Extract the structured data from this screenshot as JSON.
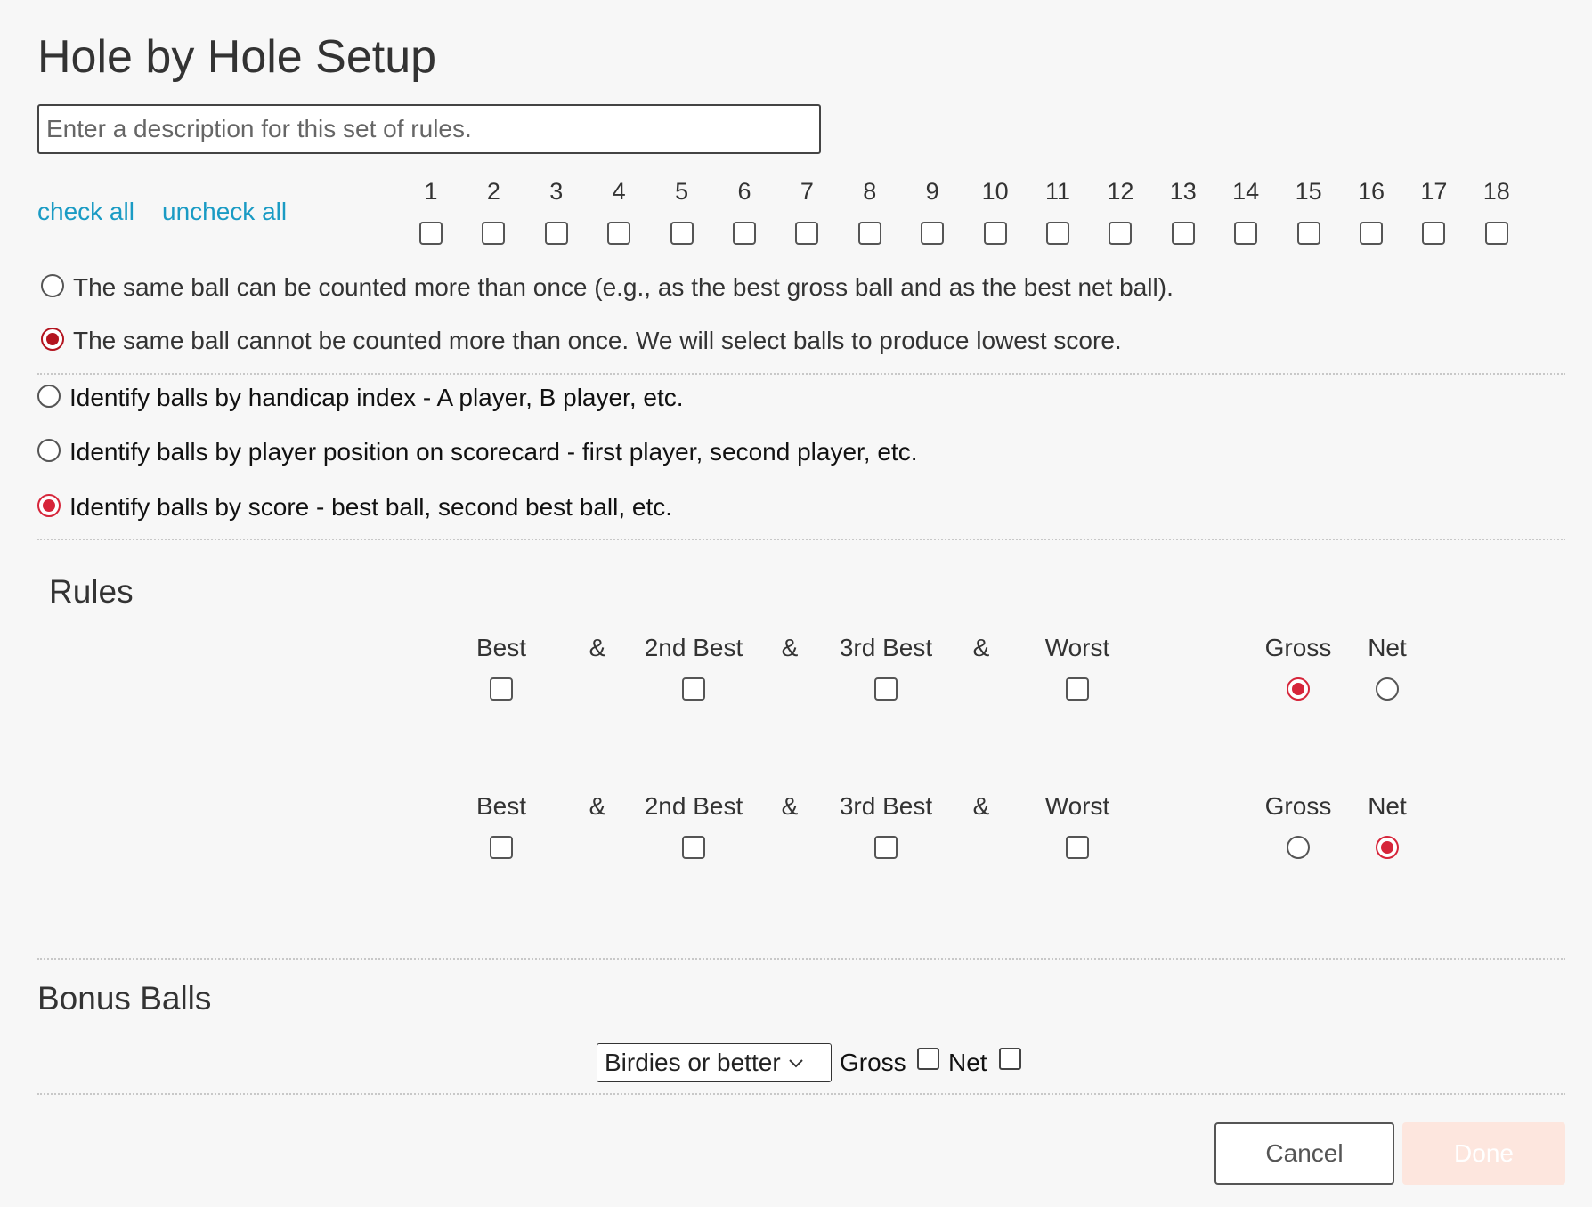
{
  "title": "Hole by Hole Setup",
  "description_input": {
    "placeholder": "Enter a description for this set of rules.",
    "value": ""
  },
  "links": {
    "check_all": "check all",
    "uncheck_all": "uncheck all"
  },
  "holes": [
    "1",
    "2",
    "3",
    "4",
    "5",
    "6",
    "7",
    "8",
    "9",
    "10",
    "11",
    "12",
    "13",
    "14",
    "15",
    "16",
    "17",
    "18"
  ],
  "ball_count_options": [
    {
      "label": "The same ball can be counted more than once (e.g., as the best gross ball and as the best net ball).",
      "selected": false
    },
    {
      "label": "The same ball cannot be counted more than once. We will select balls to produce lowest score.",
      "selected": true
    }
  ],
  "identify_options": [
    {
      "label": "Identify balls by handicap index - A player, B player, etc.",
      "selected": false
    },
    {
      "label": "Identify balls by player position on scorecard - first player, second player, etc.",
      "selected": false
    },
    {
      "label": "Identify balls by score - best ball, second best ball, etc.",
      "selected": true
    }
  ],
  "rules": {
    "heading": "Rules",
    "rows": [
      {
        "labels": {
          "best": "Best",
          "amp1": "&",
          "second": "2nd Best",
          "amp2": "&",
          "third": "3rd Best",
          "amp3": "&",
          "worst": "Worst",
          "gross": "Gross",
          "net": "Net"
        },
        "score_type": "gross"
      },
      {
        "labels": {
          "best": "Best",
          "amp1": "&",
          "second": "2nd Best",
          "amp2": "&",
          "third": "3rd Best",
          "amp3": "&",
          "worst": "Worst",
          "gross": "Gross",
          "net": "Net"
        },
        "score_type": "net"
      }
    ]
  },
  "bonus": {
    "heading": "Bonus Balls",
    "select_value": "Birdies or better",
    "gross_label": "Gross",
    "net_label": "Net"
  },
  "buttons": {
    "cancel": "Cancel",
    "done": "Done"
  },
  "colors": {
    "accent": "#d6253a",
    "link": "#1a9bc4",
    "done_disabled": "#fde6de"
  }
}
